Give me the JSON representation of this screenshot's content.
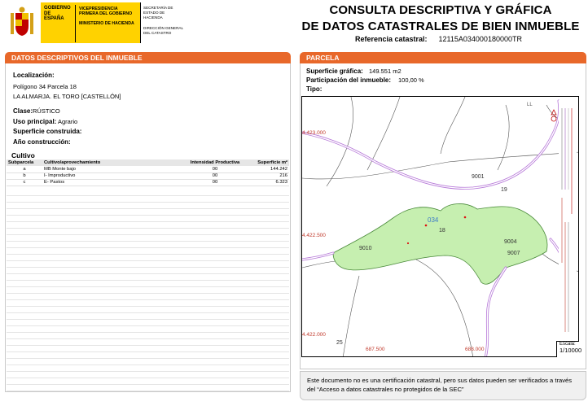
{
  "header": {
    "gov_gobierno": "GOBIERNO DE ESPAÑA",
    "gov_vice": "VICEPRESIDENCIA PRIMERA DEL GOBIERNO",
    "gov_ministerio": "MINISTERIO DE HACIENDA",
    "gov_secretaria": "SECRETARÍA DE ESTADO DE HACIENDA",
    "gov_direccion": "DIRECCIÓN GENERAL DEL CATASTRO",
    "title_line1": "CONSULTA DESCRIPTIVA Y GRÁFICA",
    "title_line2": "DE DATOS CATASTRALES DE BIEN INMUEBLE",
    "ref_label": "Referencia catastral:",
    "ref_value": "12115A034000180000TR"
  },
  "left": {
    "section_title": "DATOS DESCRIPTIVOS DEL INMUEBLE",
    "localizacion_label": "Localización:",
    "localizacion_line1": "Polígono 34 Parcela 18",
    "localizacion_line2": "LA ALMARJA. EL TORO [CASTELLÓN]",
    "clase_label": "Clase:",
    "clase_value": "RÚSTICO",
    "uso_label": "Uso principal:",
    "uso_value": "Agrario",
    "superficie_label": "Superficie construida:",
    "ano_label": "Año construcción:",
    "cultivo_title": "Cultivo",
    "table_headers": [
      "Subparcela",
      "Cultivo/aprovechamiento",
      "Intensidad Productiva",
      "Superficie m²"
    ],
    "table_rows": [
      [
        "a",
        "MB Monte bajo",
        "00",
        "144.242"
      ],
      [
        "b",
        "I- Improductivo",
        "00",
        "216"
      ],
      [
        "c",
        "E- Pastos",
        "00",
        "6.323"
      ]
    ]
  },
  "right": {
    "section_title": "PARCELA",
    "sup_grafica_label": "Superficie gráfica:",
    "sup_grafica_value": "149.551 m2",
    "participacion_label": "Participación del inmueble:",
    "participacion_value": "100,00 %",
    "tipo_label": "Tipo:",
    "map": {
      "coord_y1": "4.423.000",
      "coord_y2": "4.422.500",
      "coord_y3": "4.422.000",
      "coord_x1": "687.500",
      "coord_x2": "688.000",
      "parcel_number": "034",
      "parcel_sub": "18",
      "label_9001": "9001",
      "label_19": "19",
      "label_9010": "9010",
      "label_9004": "9004",
      "label_9007": "9007",
      "label_25": "25",
      "label_top": "LL"
    },
    "scale_label": "Escala:",
    "scale_value": "1/10000",
    "note": "Este documento no es una certificación catastral, pero sus datos pueden ser verificados a través del “Acceso a datos catastrales no protegidos de la SEC”"
  },
  "colors": {
    "orange": "#e8682a",
    "parcel_fill": "#c6efb0",
    "road": "#b678d8",
    "gov_yellow": "#ffd200"
  }
}
